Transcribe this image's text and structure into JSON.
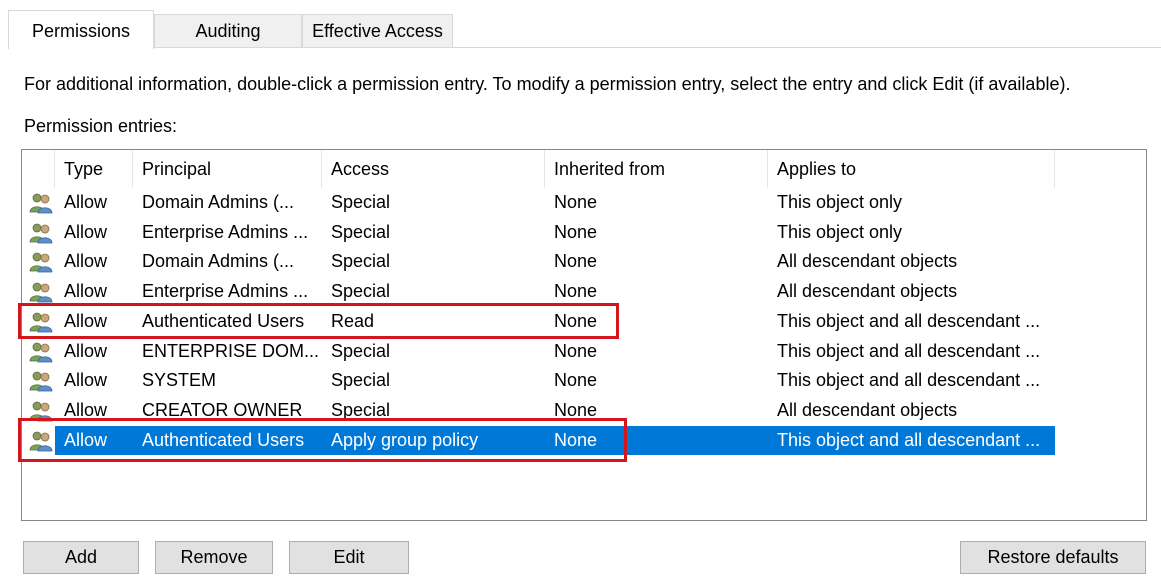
{
  "tabs": [
    {
      "label": "Permissions",
      "active": true
    },
    {
      "label": "Auditing",
      "active": false
    },
    {
      "label": "Effective Access",
      "active": false
    }
  ],
  "info_text": "For additional information, double-click a permission entry. To modify a permission entry, select the entry and click Edit (if available).",
  "entries_label": "Permission entries:",
  "columns": [
    "Type",
    "Principal",
    "Access",
    "Inherited from",
    "Applies to"
  ],
  "rows": [
    {
      "type": "Allow",
      "principal": "Domain Admins (...",
      "access": "Special",
      "inherited": "None",
      "applies": "This object only"
    },
    {
      "type": "Allow",
      "principal": "Enterprise Admins ...",
      "access": "Special",
      "inherited": "None",
      "applies": "This object only"
    },
    {
      "type": "Allow",
      "principal": "Domain Admins (...",
      "access": "Special",
      "inherited": "None",
      "applies": "All descendant objects"
    },
    {
      "type": "Allow",
      "principal": "Enterprise Admins ...",
      "access": "Special",
      "inherited": "None",
      "applies": "All descendant objects"
    },
    {
      "type": "Allow",
      "principal": "Authenticated Users",
      "access": "Read",
      "inherited": "None",
      "applies": "This object and all descendant ...",
      "highlighted": true
    },
    {
      "type": "Allow",
      "principal": "ENTERPRISE DOM...",
      "access": "Special",
      "inherited": "None",
      "applies": "This object and all descendant ..."
    },
    {
      "type": "Allow",
      "principal": "SYSTEM",
      "access": "Special",
      "inherited": "None",
      "applies": "This object and all descendant ..."
    },
    {
      "type": "Allow",
      "principal": "CREATOR OWNER",
      "access": "Special",
      "inherited": "None",
      "applies": "All descendant objects"
    },
    {
      "type": "Allow",
      "principal": "Authenticated Users",
      "access": "Apply group policy",
      "inherited": "None",
      "applies": "This object and all descendant ...",
      "selected": true,
      "highlighted": true
    }
  ],
  "row_icon": "user-group-icon",
  "buttons": {
    "add": "Add",
    "remove": "Remove",
    "edit": "Edit",
    "restore": "Restore defaults"
  },
  "colors": {
    "selection": "#0078d7",
    "highlight_box": "#d4151b"
  }
}
